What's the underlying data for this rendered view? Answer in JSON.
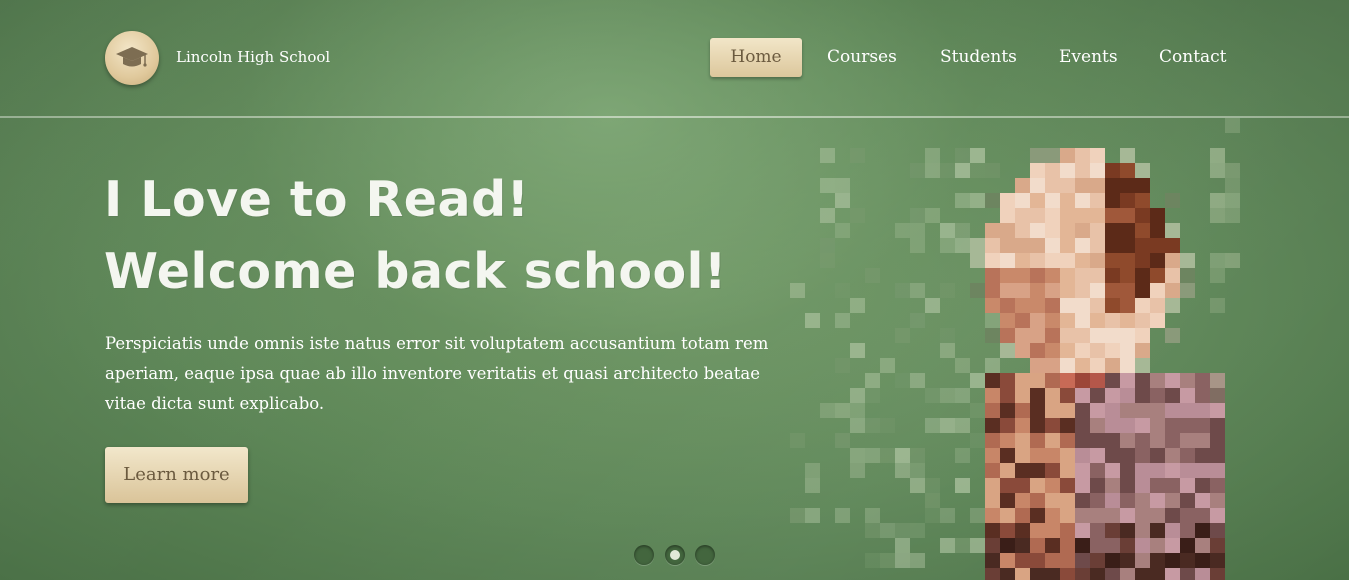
{
  "header": {
    "logo_text": "Lincoln High School",
    "logo_icon": "graduation-cap-icon",
    "nav": [
      {
        "label": "Home",
        "active": true
      },
      {
        "label": "Courses",
        "active": false
      },
      {
        "label": "Students",
        "active": false
      },
      {
        "label": "Events",
        "active": false
      },
      {
        "label": "Contact",
        "active": false
      }
    ]
  },
  "hero": {
    "headline_line1": "I Love to Read!",
    "headline_line2": "Welcome back school!",
    "description": "Perspiciatis unde omnis iste natus error sit voluptatem accusantium totam rem aperiam, eaque ipsa quae ab illo inventore veritatis et quasi architecto beatae vitae dicta sunt explicabo.",
    "button_label": "Learn more"
  },
  "slider": {
    "slide_count": 3,
    "active_index": 1
  },
  "colors": {
    "board_green": "#5f8a5a",
    "button_cream": "#e6d4ac",
    "button_text": "#6b5a3f"
  }
}
